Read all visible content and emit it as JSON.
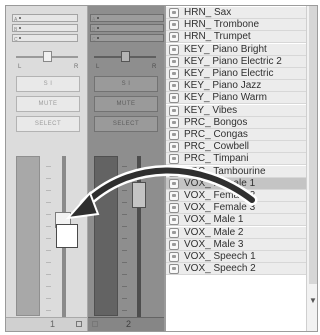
{
  "mixer": {
    "channels": [
      {
        "number": "1",
        "send_marks": [
          "A",
          "B",
          "C"
        ],
        "pan_left": "L",
        "pan_right": "R",
        "buttons": [
          "S  I",
          "MUTE",
          "SELECT"
        ]
      },
      {
        "number": "2",
        "send_marks": [
          "A",
          "B",
          "C"
        ],
        "pan_left": "L",
        "pan_right": "R",
        "buttons": [
          "S  I",
          "MUTE",
          "SELECT"
        ]
      }
    ]
  },
  "instrument_list": {
    "selected_index": 14,
    "items": [
      "HRN_ Sax",
      "HRN_ Trombone",
      "HRN_ Trumpet",
      "KEY_ Piano Bright",
      "KEY_ Piano Electric 2",
      "KEY_ Piano Electric",
      "KEY_ Piano Jazz",
      "KEY_ Piano Warm",
      "KEY_ Vibes",
      "PRC_ Bongos",
      "PRC_ Congas",
      "PRC_ Cowbell",
      "PRC_ Timpani",
      "PRC_ Tambourine",
      "VOX_ Female 1",
      "VOX_ Female 2",
      "VOX_ Female 3",
      "VOX_ Male 1",
      "VOX_ Male 2",
      "VOX_ Male 3",
      "VOX_ Speech 1",
      "VOX_ Speech 2"
    ],
    "scroll_down_icon": "triangle-down"
  },
  "colors": {
    "drag_arrow": "#2f2f2f",
    "drag_arrow_outline": "#ffffff",
    "selected_row": "#c4c4c4"
  }
}
